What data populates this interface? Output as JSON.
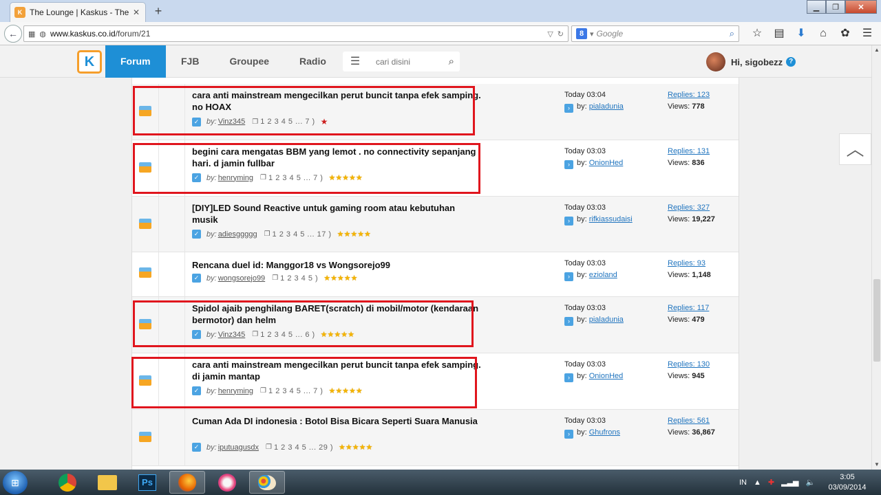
{
  "browser": {
    "tab_title": "The Lounge | Kaskus - The ...",
    "tab_favicon": "K",
    "newtab_label": "+",
    "url_host": "www.kaskus.co.id",
    "url_path": "/forum/21",
    "search_engine": "Google",
    "search_badge": "8"
  },
  "header": {
    "logo": "K",
    "nav": [
      "Forum",
      "FJB",
      "Groupee",
      "Radio"
    ],
    "search_placeholder": "cari disini",
    "greeting": "Hi, sigobezz"
  },
  "threads": [
    {
      "title": "cara anti mainstream mengecilkan perut buncit tanpa efek samping. no HOAX",
      "author": "Vinz345",
      "pages": "1 2 3 4 5 ... 7 )",
      "rating": "red-star",
      "last_time": "Today 03:04",
      "last_user": "pialadunia",
      "replies": "Replies: 123",
      "views": "778",
      "highlight": true
    },
    {
      "title": "begini cara mengatas BBM yang lemot . no connectivity sepanjang hari. d jamin fullbar",
      "author": "henryming",
      "pages": "1 2 3 4 5 ... 7 )",
      "rating": "★★★★★",
      "last_time": "Today 03:03",
      "last_user": "OnionHed",
      "replies": "Replies: 131",
      "views": "836",
      "highlight": true
    },
    {
      "title": "[DIY]LED Sound Reactive untuk gaming room atau kebutuhan musik",
      "author": "adiesggggg",
      "pages": "1 2 3 4 5 ... 17 )",
      "rating": "★★★★★",
      "last_time": "Today 03:03",
      "last_user": "rifkiassudaisi",
      "replies": "Replies: 327",
      "views": "19,227",
      "highlight": false
    },
    {
      "title": "Rencana duel id: Manggor18 vs Wongsorejo99",
      "author": "wongsorejo99",
      "pages": "1 2 3 4 5 )",
      "rating": "★★★★★",
      "last_time": "Today 03:03",
      "last_user": "ezioland",
      "replies": "Replies: 93",
      "views": "1,148",
      "highlight": false
    },
    {
      "title": "Spidol ajaib penghilang BARET(scratch) di mobil/motor (kendaraan bermotor) dan helm",
      "author": "Vinz345",
      "pages": "1 2 3 4 5 ... 6 )",
      "rating": "★★★★★",
      "last_time": "Today 03:03",
      "last_user": "pialadunia",
      "replies": "Replies: 117",
      "views": "479",
      "highlight": true
    },
    {
      "title": "cara anti mainstream mengecilkan perut buncit tanpa efek samping. di jamin mantap",
      "author": "henryming",
      "pages": "1 2 3 4 5 ... 7 )",
      "rating": "★★★★★",
      "last_time": "Today 03:03",
      "last_user": "OnionHed",
      "replies": "Replies: 130",
      "views": "945",
      "highlight": true
    },
    {
      "title": "Cuman Ada DI indonesia : Botol Bisa Bicara Seperti Suara Manusia",
      "author": "iputuagusdx",
      "pages": "1 2 3 4 5 ... 29 )",
      "rating": "★★★★★",
      "last_time": "Today 03:03",
      "last_user": "Ghufrons",
      "replies": "Replies: 561",
      "views": "36,867",
      "highlight": false
    }
  ],
  "labels": {
    "by": "by:",
    "last_by": "by:",
    "views": "Views:"
  },
  "taskbar": {
    "apps": [
      "Chrome",
      "Explorer",
      "Ps",
      "Firefox",
      "App",
      "Paint"
    ],
    "lang": "IN",
    "time": "3:05",
    "date": "03/09/2014"
  },
  "colors": {
    "accent": "#1e8fd6",
    "highlight": "#e0151d",
    "logo_border": "#f59e2b"
  }
}
